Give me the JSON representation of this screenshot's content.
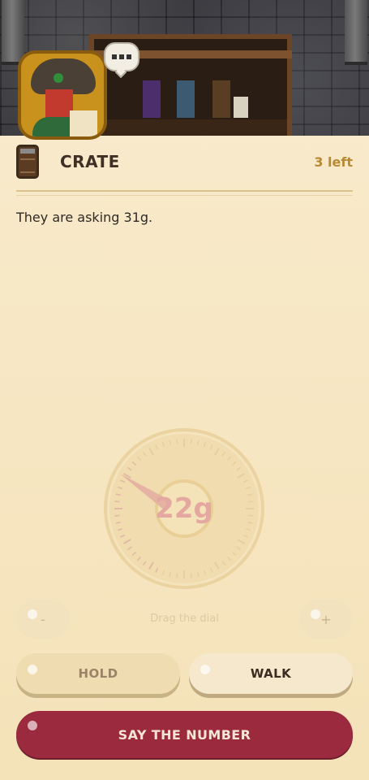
{
  "scene": {
    "speech_bubble_icon": "ellipsis-bubble-icon",
    "merchant_portrait": "merchant-portrait"
  },
  "item": {
    "icon": "crate-icon",
    "name": "CRATE",
    "remaining": "3 left"
  },
  "prompt": "They are asking 31g.",
  "dial": {
    "value": "22g",
    "hint": "Drag the dial"
  },
  "controls": {
    "minus_label": "-",
    "plus_label": "+",
    "hold_label": "HOLD",
    "walk_label": "WALK",
    "say_label": "SAY THE NUMBER"
  },
  "colors": {
    "background": "#f8ebcf",
    "accent_gold": "#b98a34",
    "primary_button": "#9b2a3e",
    "dial_value": "#e4a8a0"
  }
}
